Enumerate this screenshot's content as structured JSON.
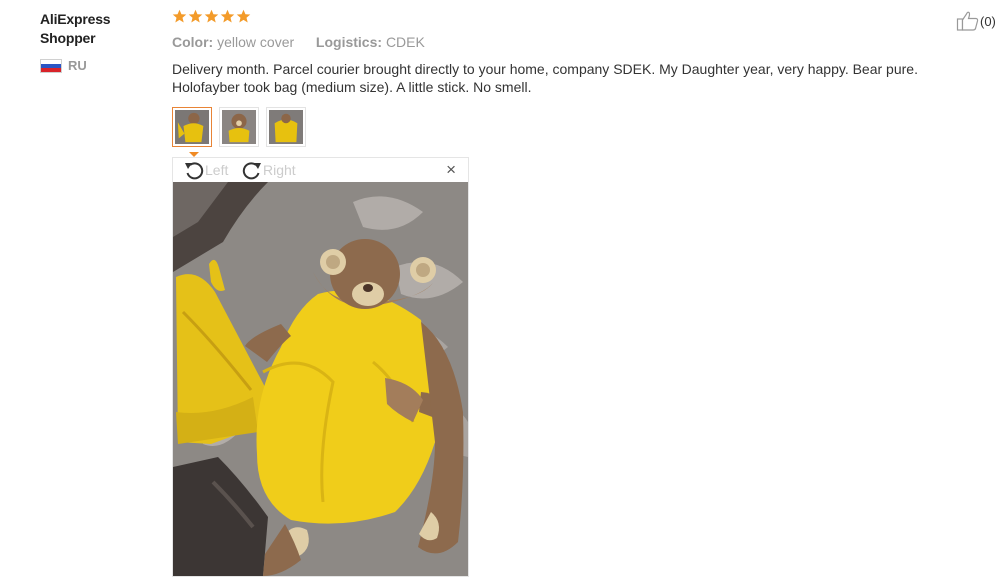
{
  "user": {
    "name": "AliExpress Shopper",
    "country": "RU"
  },
  "rating": {
    "stars": 5,
    "color": "#f39b2a"
  },
  "meta": {
    "color_label": "Color:",
    "color_value": "yellow cover",
    "logistics_label": "Logistics:",
    "logistics_value": "CDEK"
  },
  "review": {
    "text": "Delivery month. Parcel courier brought directly to your home, company SDEK. My Daughter year, very happy. Bear pure. Holofayber took bag (medium size). A little stick. No smell."
  },
  "helpful": {
    "icon": "thumbs-up-icon",
    "count": "(0)"
  },
  "photos": {
    "thumbnail_count": 3,
    "selected_index": 0
  },
  "viewer": {
    "rotate_left_label": "Left",
    "rotate_right_label": "Right",
    "close_label": "×"
  }
}
